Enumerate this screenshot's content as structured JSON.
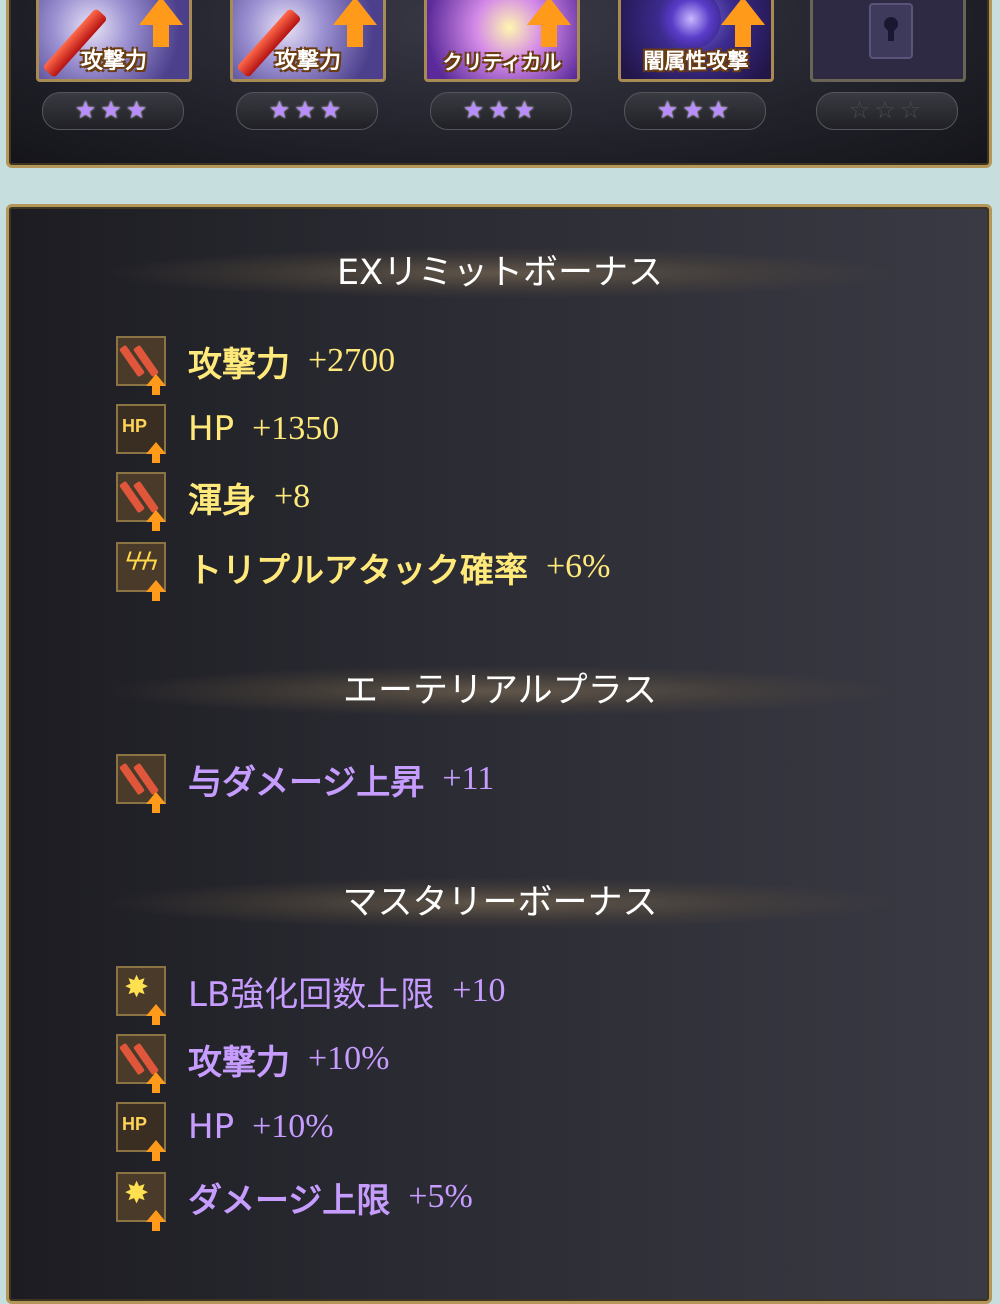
{
  "skills": [
    {
      "label": "攻撃力",
      "stars": "★★★",
      "type": "atk"
    },
    {
      "label": "攻撃力",
      "stars": "★★★",
      "type": "atk"
    },
    {
      "label": "クリティカル",
      "stars": "★★★",
      "type": "crit"
    },
    {
      "label": "闇属性攻撃",
      "stars": "★★★",
      "type": "dark"
    },
    {
      "label": "",
      "stars": "☆☆☆",
      "type": "locked"
    }
  ],
  "ex_limit": {
    "title": "EXリミットボーナス",
    "items": [
      {
        "name": "攻撃力",
        "value": "+2700",
        "icon": "sword-icon"
      },
      {
        "name": "HP",
        "value": "+1350",
        "icon": "hp-icon"
      },
      {
        "name": "渾身",
        "value": "+8",
        "icon": "sword-icon"
      },
      {
        "name": "トリプルアタック確率",
        "value": "+6%",
        "icon": "triple-attack-icon"
      }
    ]
  },
  "ethereal": {
    "title": "エーテリアルプラス",
    "items": [
      {
        "name": "与ダメージ上昇",
        "value": "+11",
        "icon": "sword-icon"
      }
    ]
  },
  "mastery": {
    "title": "マスタリーボーナス",
    "items": [
      {
        "name": "LB強化回数上限",
        "value": "+10",
        "icon": "burst-icon"
      },
      {
        "name": "攻撃力",
        "value": "+10%",
        "icon": "sword-icon"
      },
      {
        "name": "HP",
        "value": "+10%",
        "icon": "hp-icon"
      },
      {
        "name": "ダメージ上限",
        "value": "+5%",
        "icon": "burst-icon"
      }
    ]
  },
  "colors": {
    "frame_gold": "#b49758",
    "stat_yellow": "#ffe97a",
    "stat_purple": "#c79cff",
    "boost_orange": "#ff9a1a"
  }
}
